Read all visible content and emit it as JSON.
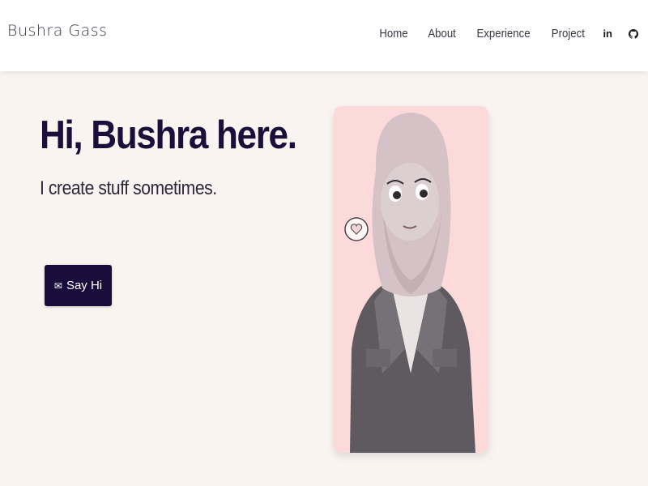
{
  "header": {
    "brand": "Bushra Gass",
    "nav": [
      "Home",
      "About",
      "Experience",
      "Project"
    ],
    "social": [
      {
        "icon": "linkedin-icon",
        "text": "in"
      },
      {
        "icon": "github-icon"
      }
    ]
  },
  "hero": {
    "title": "Hi, Bushra here.",
    "subtitle": "I create stuff sometimes.",
    "cta": {
      "icon": "mail-icon",
      "label": "Say Hi"
    }
  },
  "portrait": {
    "icon": "avatar-illustration"
  },
  "colors": {
    "background": "#faf4f1",
    "header_bg": "#ffffff",
    "accent": "#1b0c3c",
    "portrait_bg": "#fcdada"
  }
}
